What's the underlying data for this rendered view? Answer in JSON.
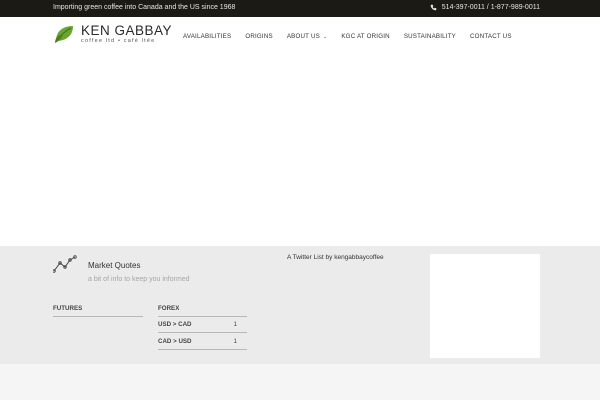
{
  "topbar": {
    "tagline": "Importing green coffee into Canada and the US since 1968",
    "phone": "514-397-0011 / 1-877-989-0011"
  },
  "logo": {
    "name": "KEN GABBAY",
    "sub": "coffee ltd • café ltée"
  },
  "nav": {
    "items": [
      {
        "label": "AVAILABILITIES"
      },
      {
        "label": "ORIGINS"
      },
      {
        "label": "ABOUT US",
        "chevron": "⌄"
      },
      {
        "label": "KGC AT ORIGIN"
      },
      {
        "label": "SUSTAINABILITY"
      },
      {
        "label": "CONTACT US"
      }
    ]
  },
  "footer": {
    "market_title": "Market Quotes",
    "market_sub": "a bit of info to keep you informed",
    "futures_label": "FUTURES",
    "forex_label": "FOREX",
    "forex_rows": [
      {
        "pair": "USD > CAD",
        "value": "1"
      },
      {
        "pair": "CAD > USD",
        "value": "1"
      }
    ],
    "twitter_text": "A Twitter List by kengabbaycoffee"
  },
  "colors": {
    "topbar_bg": "#1c1a14",
    "footer_bg": "#ebebeb",
    "logo_green": "#6aa532"
  }
}
